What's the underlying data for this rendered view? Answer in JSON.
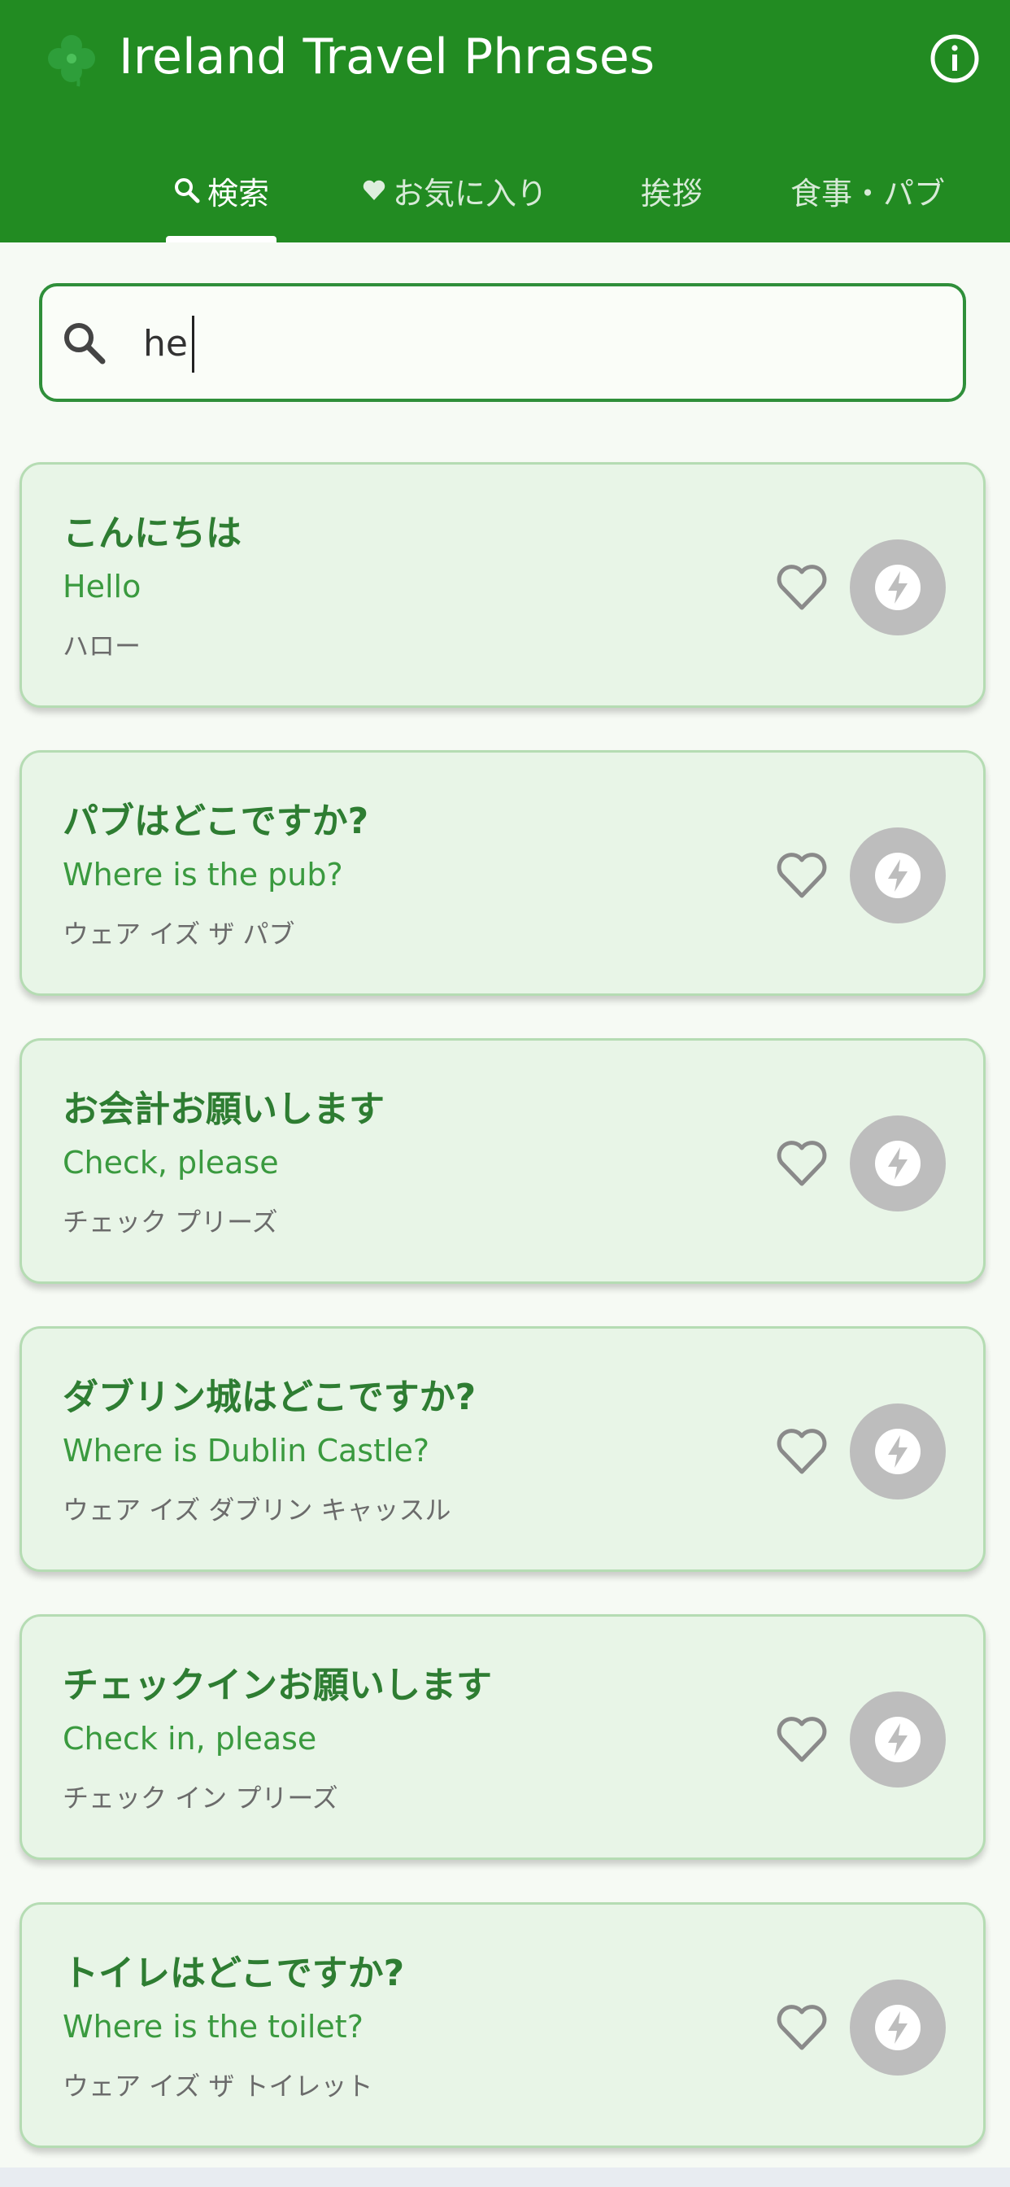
{
  "header": {
    "title": "Ireland Travel Phrases",
    "logo_icon": "shamrock-icon",
    "info_icon": "info-icon"
  },
  "tabs": [
    {
      "label": "検索",
      "icon": "search-icon",
      "active": true
    },
    {
      "label": "お気に入り",
      "icon": "heart-icon",
      "active": false
    },
    {
      "label": "挨拶",
      "active": false
    },
    {
      "label": "食事・パブ",
      "active": false
    }
  ],
  "search": {
    "value": "he"
  },
  "phrases": [
    {
      "jp": "こんにちは",
      "en": "Hello",
      "kana": "ハロー"
    },
    {
      "jp": "パブはどこですか?",
      "en": "Where is the pub?",
      "kana": "ウェア イズ ザ パブ"
    },
    {
      "jp": "お会計お願いします",
      "en": "Check, please",
      "kana": "チェック プリーズ"
    },
    {
      "jp": "ダブリン城はどこですか?",
      "en": "Where is Dublin Castle?",
      "kana": "ウェア イズ ダブリン キャッスル"
    },
    {
      "jp": "チェックインお願いします",
      "en": "Check in, please",
      "kana": "チェック イン プリーズ"
    },
    {
      "jp": "トイレはどこですか?",
      "en": "Where is the toilet?",
      "kana": "ウェア イズ ザ トイレット"
    }
  ],
  "colors": {
    "header_bg": "#228b22",
    "card_bg": "#e8f5e7",
    "phrase_green": "#2e7d32",
    "play_button": "#bdbdbd"
  }
}
